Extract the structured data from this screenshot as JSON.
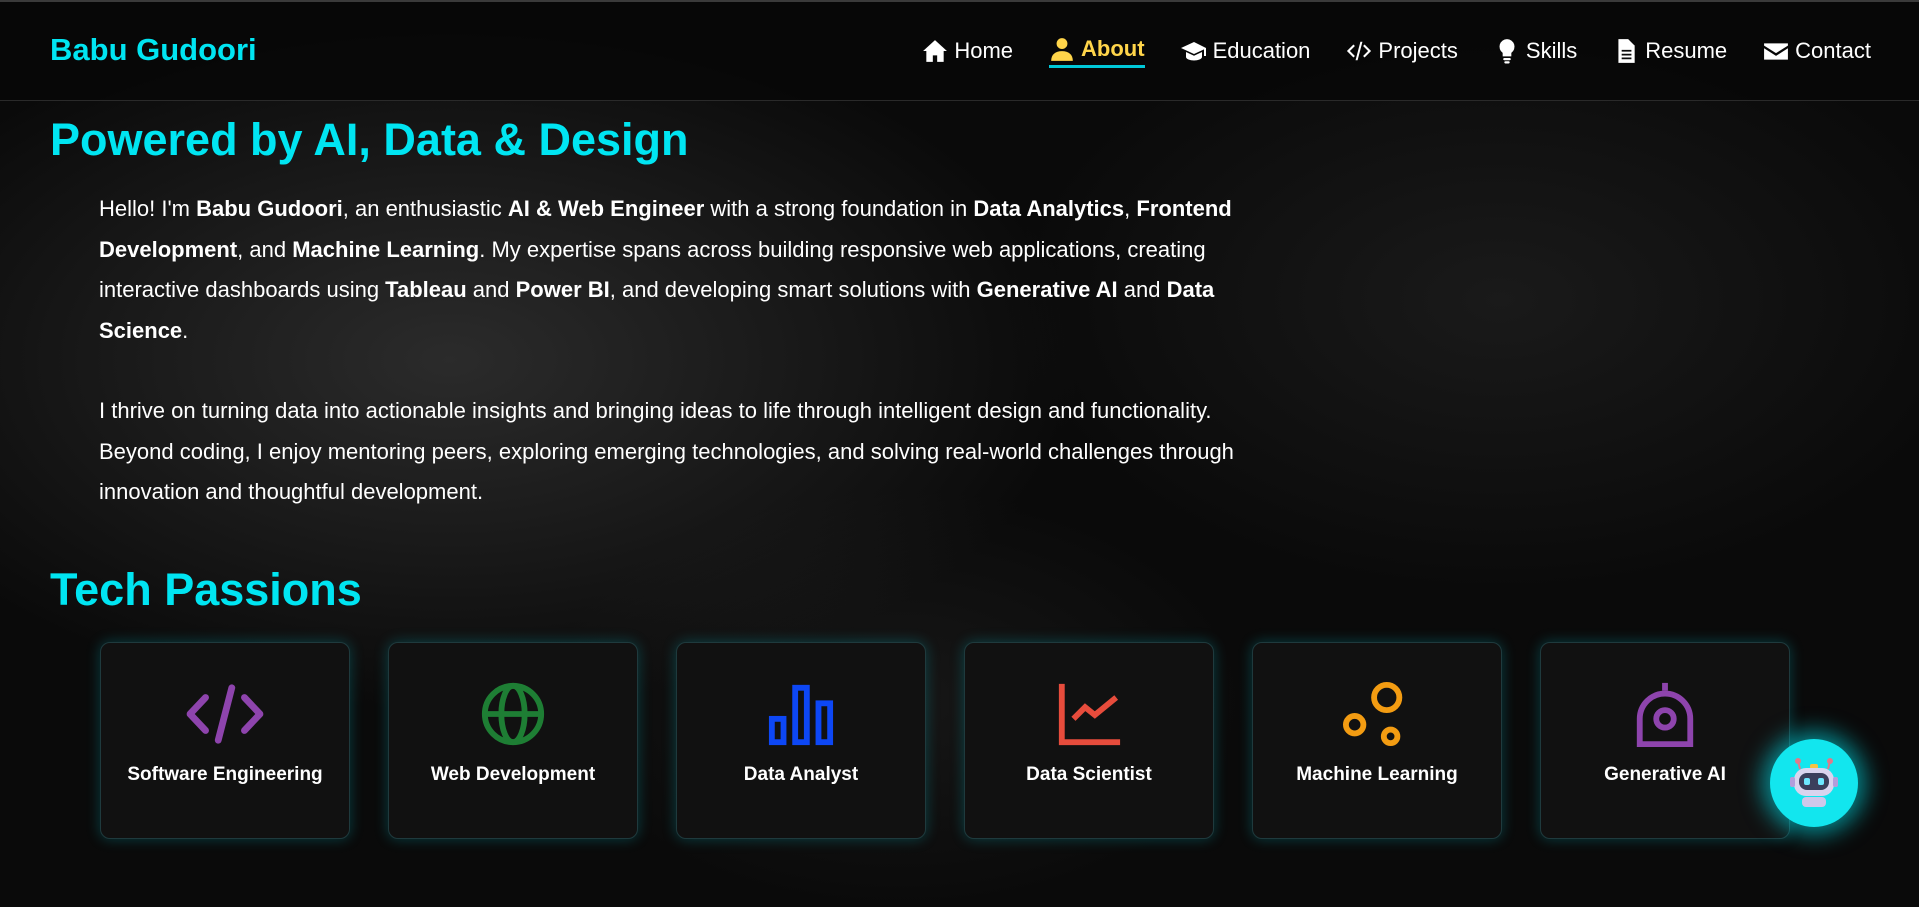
{
  "header": {
    "brand": "Babu Gudoori",
    "nav": [
      {
        "label": "Home",
        "icon": "home-icon"
      },
      {
        "label": "About",
        "icon": "user-icon",
        "active": true
      },
      {
        "label": "Education",
        "icon": "graduation-cap-icon"
      },
      {
        "label": "Projects",
        "icon": "code-icon"
      },
      {
        "label": "Skills",
        "icon": "lightbulb-icon"
      },
      {
        "label": "Resume",
        "icon": "file-icon"
      },
      {
        "label": "Contact",
        "icon": "envelope-icon"
      }
    ]
  },
  "about": {
    "title": "Powered by AI, Data & Design",
    "p1": {
      "t1": "Hello! I'm ",
      "b1": "Babu Gudoori",
      "t2": ", an enthusiastic ",
      "b2": "AI & Web Engineer",
      "t3": " with a strong foundation in ",
      "b3": "Data Analytics",
      "t4": ", ",
      "b4": "Frontend Development",
      "t5": ", and ",
      "b5": "Machine Learning",
      "t6": ". My expertise spans across building responsive web applications, creating interactive dashboards using ",
      "b6": "Tableau",
      "t7": " and ",
      "b7": "Power BI",
      "t8": ", and developing smart solutions with ",
      "b8": "Generative AI",
      "t9": " and ",
      "b9": "Data Science",
      "t10": "."
    },
    "p2": "I thrive on turning data into actionable insights and bringing ideas to life through intelligent design and functionality. Beyond coding, I enjoy mentoring peers, exploring emerging technologies, and solving real-world challenges through innovation and thoughtful development."
  },
  "tech": {
    "title": "Tech Passions",
    "cards": [
      {
        "label": "Software Engineering",
        "icon": "code-icon",
        "color": "#8e44ad"
      },
      {
        "label": "Web Development",
        "icon": "globe-icon",
        "color": "#1e7e34"
      },
      {
        "label": "Data Analyst",
        "icon": "bar-chart-icon",
        "color": "#0d47f5"
      },
      {
        "label": "Data Scientist",
        "icon": "line-chart-icon",
        "color": "#e74c3c"
      },
      {
        "label": "Machine Learning",
        "icon": "bubbles-icon",
        "color": "#f39c12"
      },
      {
        "label": "Generative AI",
        "icon": "robot-dome-icon",
        "color": "#8e44ad"
      }
    ]
  },
  "chatbot": {
    "icon": "robot-icon",
    "color": "#12e6ee"
  }
}
